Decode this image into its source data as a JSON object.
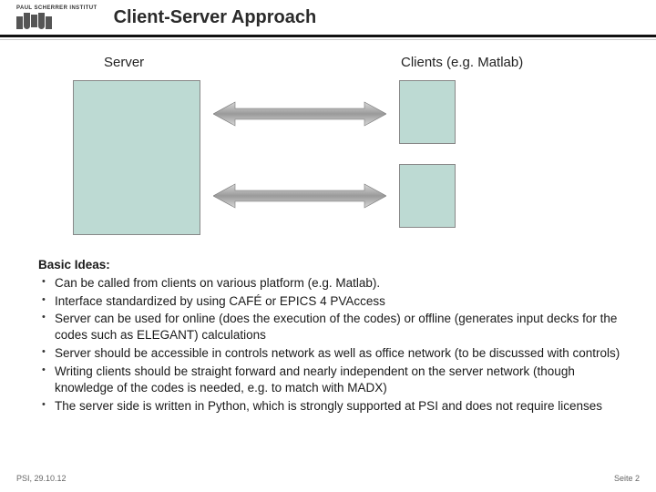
{
  "header": {
    "institute": "PAUL SCHERRER INSTITUT",
    "title": "Client-Server Approach"
  },
  "diagram": {
    "server_label": "Server",
    "clients_label": "Clients (e.g. Matlab)"
  },
  "body": {
    "heading": "Basic Ideas:",
    "bullets": [
      "Can be called from clients on various platform (e.g. Matlab).",
      "Interface standardized by using CAFÉ or EPICS 4 PVAccess",
      "Server can be used for online (does the execution of the codes) or offline (generates input decks for the codes such as ELEGANT) calculations",
      "Server should be accessible in controls network as well as office network (to be discussed with controls)",
      "Writing clients should be straight forward and nearly independent on the server network (though knowledge of the codes is needed, e.g. to match with MADX)",
      "The server side is written in Python, which is strongly supported at PSI and does not require licenses"
    ]
  },
  "footer": {
    "left": "PSI, 29.10.12",
    "right": "Seite 2"
  }
}
